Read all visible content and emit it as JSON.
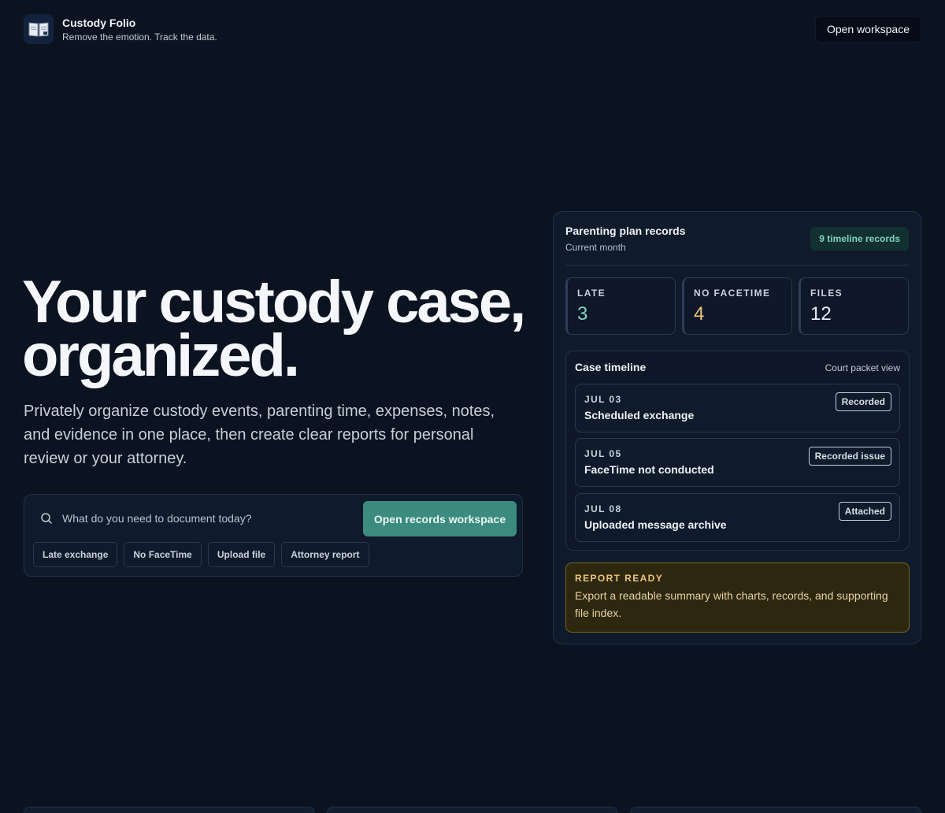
{
  "brand": {
    "name": "Custody Folio",
    "tagline": "Remove the emotion. Track the data.",
    "logo_icon": "book-logo-icon"
  },
  "header": {
    "open_workspace_label": "Open workspace"
  },
  "hero": {
    "title_line1": "Your custody case,",
    "title_line2": "organized.",
    "subtitle": "Privately organize custody events, parenting time, expenses, notes, and evidence in one place, then create clear reports for personal review or your attorney."
  },
  "search": {
    "placeholder": "What do you need to document today?",
    "button_label": "Open records workspace",
    "chips": [
      "Late exchange",
      "No FaceTime",
      "Upload file",
      "Attorney report"
    ]
  },
  "panel": {
    "title": "Parenting plan records",
    "subtitle": "Current month",
    "badge": "9 timeline records",
    "stats": [
      {
        "label": "LATE",
        "value": "3",
        "color": "#7fd3c2"
      },
      {
        "label": "NO FACETIME",
        "value": "4",
        "color": "#f0c57a"
      },
      {
        "label": "FILES",
        "value": "12",
        "color": "#e6ebf2"
      }
    ],
    "timeline": {
      "title": "Case timeline",
      "link": "Court packet view",
      "events": [
        {
          "date": "JUL 03",
          "title": "Scheduled exchange",
          "status": "Recorded"
        },
        {
          "date": "JUL 05",
          "title": "FaceTime not conducted",
          "status": "Recorded issue"
        },
        {
          "date": "JUL 08",
          "title": "Uploaded message archive",
          "status": "Attached"
        }
      ]
    },
    "report": {
      "label": "REPORT READY",
      "text": "Export a readable summary with charts, records, and supporting file index."
    }
  },
  "colors": {
    "background": "#0b1321",
    "accent": "#3b8b7f",
    "report_bg": "#2e2710"
  }
}
